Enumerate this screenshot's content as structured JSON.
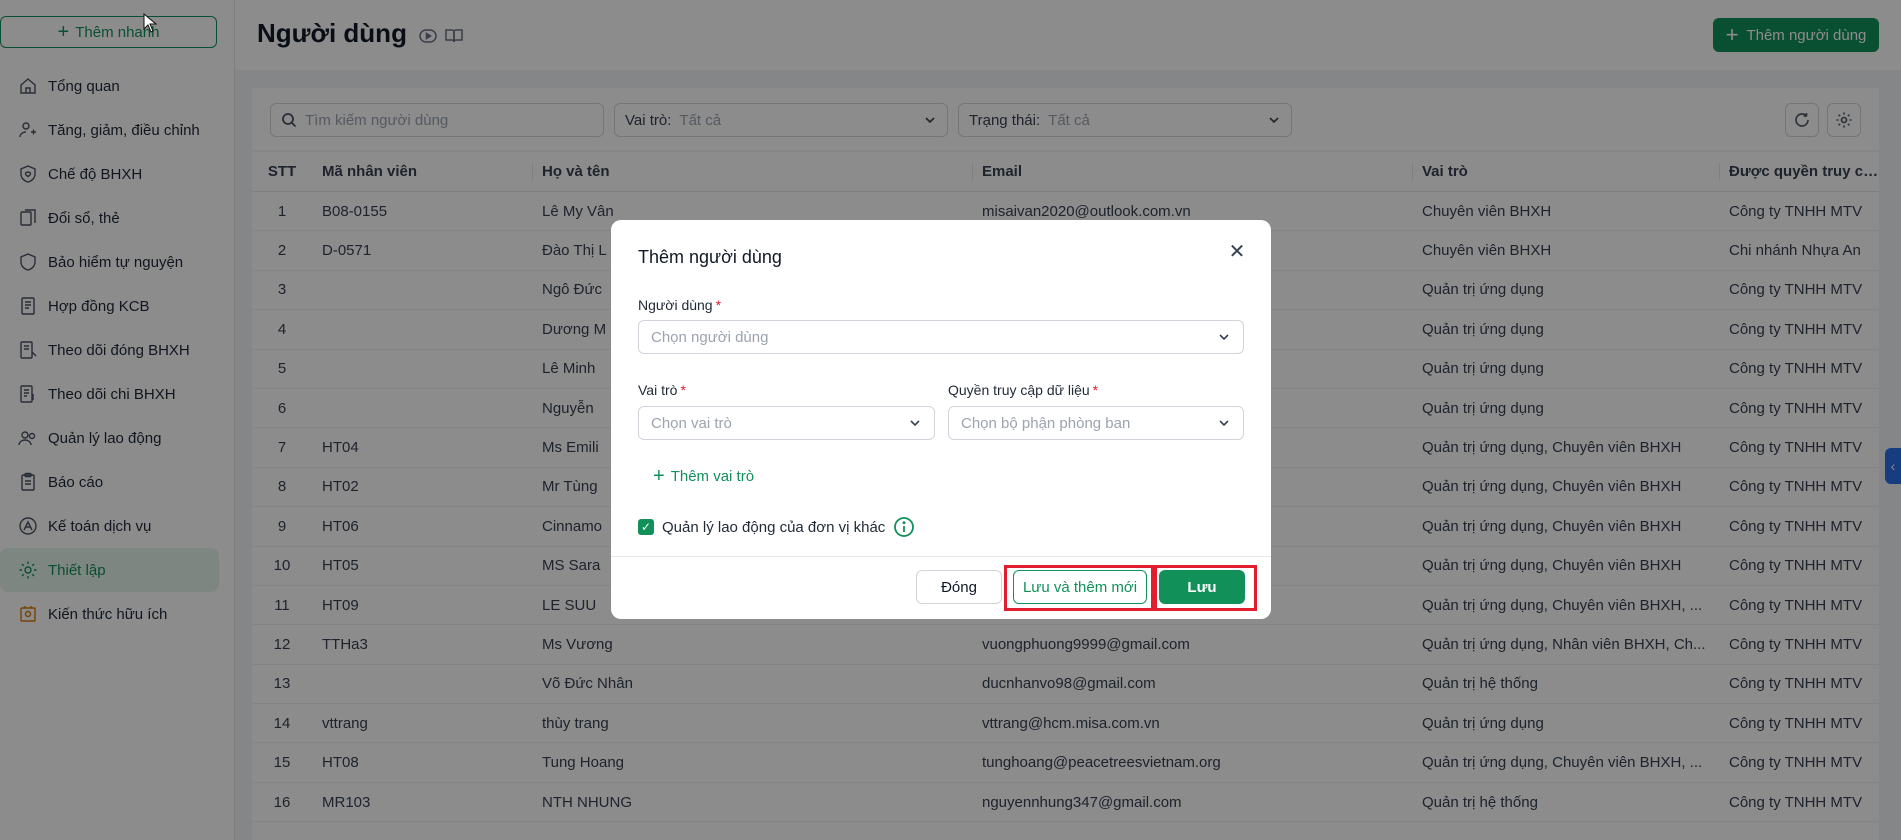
{
  "sidebar": {
    "add_group": "Thêm nhanh",
    "items": [
      {
        "label": "Tổng quan",
        "icon": "home-icon"
      },
      {
        "label": "Tăng, giảm, điều chỉnh",
        "icon": "user-adjust-icon"
      },
      {
        "label": "Chế độ BHXH",
        "icon": "shield-heart-icon"
      },
      {
        "label": "Đổi sổ, thẻ",
        "icon": "card-swap-icon"
      },
      {
        "label": "Bảo hiểm tự nguyện",
        "icon": "shield-icon"
      },
      {
        "label": "Hợp đồng KCB",
        "icon": "contract-icon"
      },
      {
        "label": "Theo dõi đóng BHXH",
        "icon": "ledger-icon"
      },
      {
        "label": "Theo dõi chi BHXH",
        "icon": "payout-icon"
      },
      {
        "label": "Quản lý lao động",
        "icon": "people-icon"
      },
      {
        "label": "Báo cáo",
        "icon": "clipboard-icon"
      },
      {
        "label": "Kế toán dịch vụ",
        "icon": "accounting-icon"
      },
      {
        "label": "Thiết lập",
        "icon": "gear-icon",
        "active": true
      },
      {
        "label": "Kiến thức hữu ích",
        "icon": "knowledge-icon"
      }
    ]
  },
  "header": {
    "title": "Người dùng",
    "add_user": "Thêm người dùng"
  },
  "filters": {
    "search_placeholder": "Tìm kiếm người dùng",
    "role_label": "Vai trò:",
    "role_value": "Tất cả",
    "status_label": "Trạng thái:",
    "status_value": "Tất cả"
  },
  "table": {
    "columns": [
      "STT",
      "Mã nhân viên",
      "Họ và tên",
      "Email",
      "Vai trò",
      "Được quyền truy cập"
    ],
    "rows": [
      [
        "1",
        "B08-0155",
        "Lê My Vân",
        "misaivan2020@outlook.com.vn",
        "Chuyên viên BHXH",
        "Công ty TNHH MTV"
      ],
      [
        "2",
        "D-0571",
        "Đào Thị L",
        "",
        "Chuyên viên BHXH",
        "Chi nhánh Nhựa An"
      ],
      [
        "3",
        "",
        "Ngô Đức",
        "",
        "Quản trị ứng dụng",
        "Công ty TNHH MTV"
      ],
      [
        "4",
        "",
        "Dương M",
        "",
        "Quản trị ứng dụng",
        "Công ty TNHH MTV"
      ],
      [
        "5",
        "",
        "Lê Minh",
        "",
        "Quản trị ứng dụng",
        "Công ty TNHH MTV"
      ],
      [
        "6",
        "",
        "Nguyễn",
        "",
        "Quản trị ứng dụng",
        "Công ty TNHH MTV"
      ],
      [
        "7",
        "HT04",
        "Ms Emili",
        "",
        "Quản trị ứng dụng, Chuyên viên BHXH",
        "Công ty TNHH MTV"
      ],
      [
        "8",
        "HT02",
        "Mr Tùng",
        "",
        "Quản trị ứng dụng, Chuyên viên BHXH",
        "Công ty TNHH MTV"
      ],
      [
        "9",
        "HT06",
        "Cinnamo",
        "",
        "Quản trị ứng dụng, Chuyên viên BHXH",
        "Công ty TNHH MTV"
      ],
      [
        "10",
        "HT05",
        "MS Sara",
        "",
        "Quản trị ứng dụng, Chuyên viên BHXH",
        "Công ty TNHH MTV"
      ],
      [
        "11",
        "HT09",
        "LE SUU",
        "",
        "Quản trị ứng dụng, Chuyên viên BHXH, ...",
        "Công ty TNHH MTV"
      ],
      [
        "12",
        "TTHa3",
        "Ms Vương",
        "vuongphuong9999@gmail.com",
        "Quản trị ứng dụng, Nhân viên BHXH, Ch...",
        "Công ty TNHH MTV"
      ],
      [
        "13",
        "",
        "Võ Đức Nhân",
        "ducnhanvo98@gmail.com",
        "Quản trị hệ thống",
        "Công ty TNHH MTV"
      ],
      [
        "14",
        "vttrang",
        "thùy trang",
        "vttrang@hcm.misa.com.vn",
        "Quản trị ứng dụng",
        "Công ty TNHH MTV"
      ],
      [
        "15",
        "HT08",
        "Tung Hoang",
        "tunghoang@peacetreesvietnam.org",
        "Quản trị ứng dụng, Chuyên viên BHXH, ...",
        "Công ty TNHH MTV"
      ],
      [
        "16",
        "MR103",
        "NTH NHUNG",
        "nguyennhung347@gmail.com",
        "Quản trị hệ thống",
        "Công ty TNHH MTV"
      ]
    ]
  },
  "modal": {
    "title": "Thêm người dùng",
    "user_label": "Người dùng",
    "user_placeholder": "Chọn người dùng",
    "role_label": "Vai trò",
    "role_placeholder": "Chọn vai trò",
    "access_label": "Quyền truy cập dữ liệu",
    "access_placeholder": "Chọn bộ phận phòng ban",
    "required_mark": "*",
    "add_role": "Thêm vai trò",
    "checkbox_label": "Quản lý lao động của đơn vị khác",
    "checkbox_checked": true,
    "close_btn": "Đóng",
    "save_new_btn": "Lưu và thêm mới",
    "save_btn": "Lưu"
  },
  "colors": {
    "brand": "#12905a",
    "highlight": "#e11d2e",
    "side_tab": "#2b6de8"
  }
}
